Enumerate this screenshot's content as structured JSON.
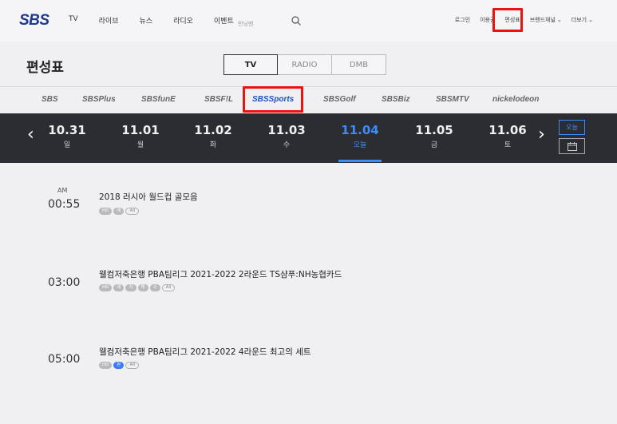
{
  "header": {
    "logo": "SBS",
    "nav": [
      "TV",
      "라이브",
      "뉴스",
      "라디오",
      "이벤트"
    ],
    "search_placeholder": "런닝맨",
    "util": {
      "login": "로그인",
      "voucher": "이용권",
      "schedule": "편성표",
      "brand_channel": "브랜드채널",
      "more": "더보기"
    }
  },
  "page": {
    "title": "편성표",
    "tabs": [
      "TV",
      "RADIO",
      "DMB"
    ],
    "active_tab": "TV"
  },
  "channels": [
    "SBS",
    "SBSPlus",
    "SBSfunE",
    "SBSF!L",
    "SBSSports",
    "SBSGolf",
    "SBSBiz",
    "SBSMTV",
    "nickelodeon"
  ],
  "active_channel": "SBSSports",
  "dates": [
    {
      "date": "10.31",
      "weekday": "일"
    },
    {
      "date": "11.01",
      "weekday": "월"
    },
    {
      "date": "11.02",
      "weekday": "화"
    },
    {
      "date": "11.03",
      "weekday": "수"
    },
    {
      "date": "11.04",
      "weekday": "오늘"
    },
    {
      "date": "11.05",
      "weekday": "금"
    },
    {
      "date": "11.06",
      "weekday": "토"
    }
  ],
  "active_date": "11.04",
  "today_button": "오늘",
  "schedule": [
    {
      "ampm": "AM",
      "time": "00:55",
      "title": "2018 러시아 월드컵 골모음",
      "badges": [
        [
          "HD",
          "fill"
        ],
        [
          "재",
          "fill"
        ],
        [
          "All",
          "line"
        ]
      ]
    },
    {
      "ampm": "",
      "time": "03:00",
      "title": "웰컴저축은행 PBA팀리그 2021-2022 2라운드 TS샴푸:NH농협카드",
      "badges": [
        [
          "HD",
          "fill"
        ],
        [
          "재",
          "fill"
        ],
        [
          "자",
          "fill"
        ],
        [
          "해",
          "fill"
        ],
        [
          "수",
          "fill"
        ],
        [
          "All",
          "line"
        ]
      ]
    },
    {
      "ampm": "",
      "time": "05:00",
      "title": "웰컴저축은행 PBA팀리그 2021-2022 4라운드 최고의 세트",
      "badges": [
        [
          "HD",
          "fill"
        ],
        [
          "본",
          "blue"
        ],
        [
          "All",
          "line"
        ]
      ]
    }
  ],
  "colors": {
    "accent": "#3b8cff",
    "highlight": "#ee1111",
    "datebar": "#2b2d33"
  }
}
